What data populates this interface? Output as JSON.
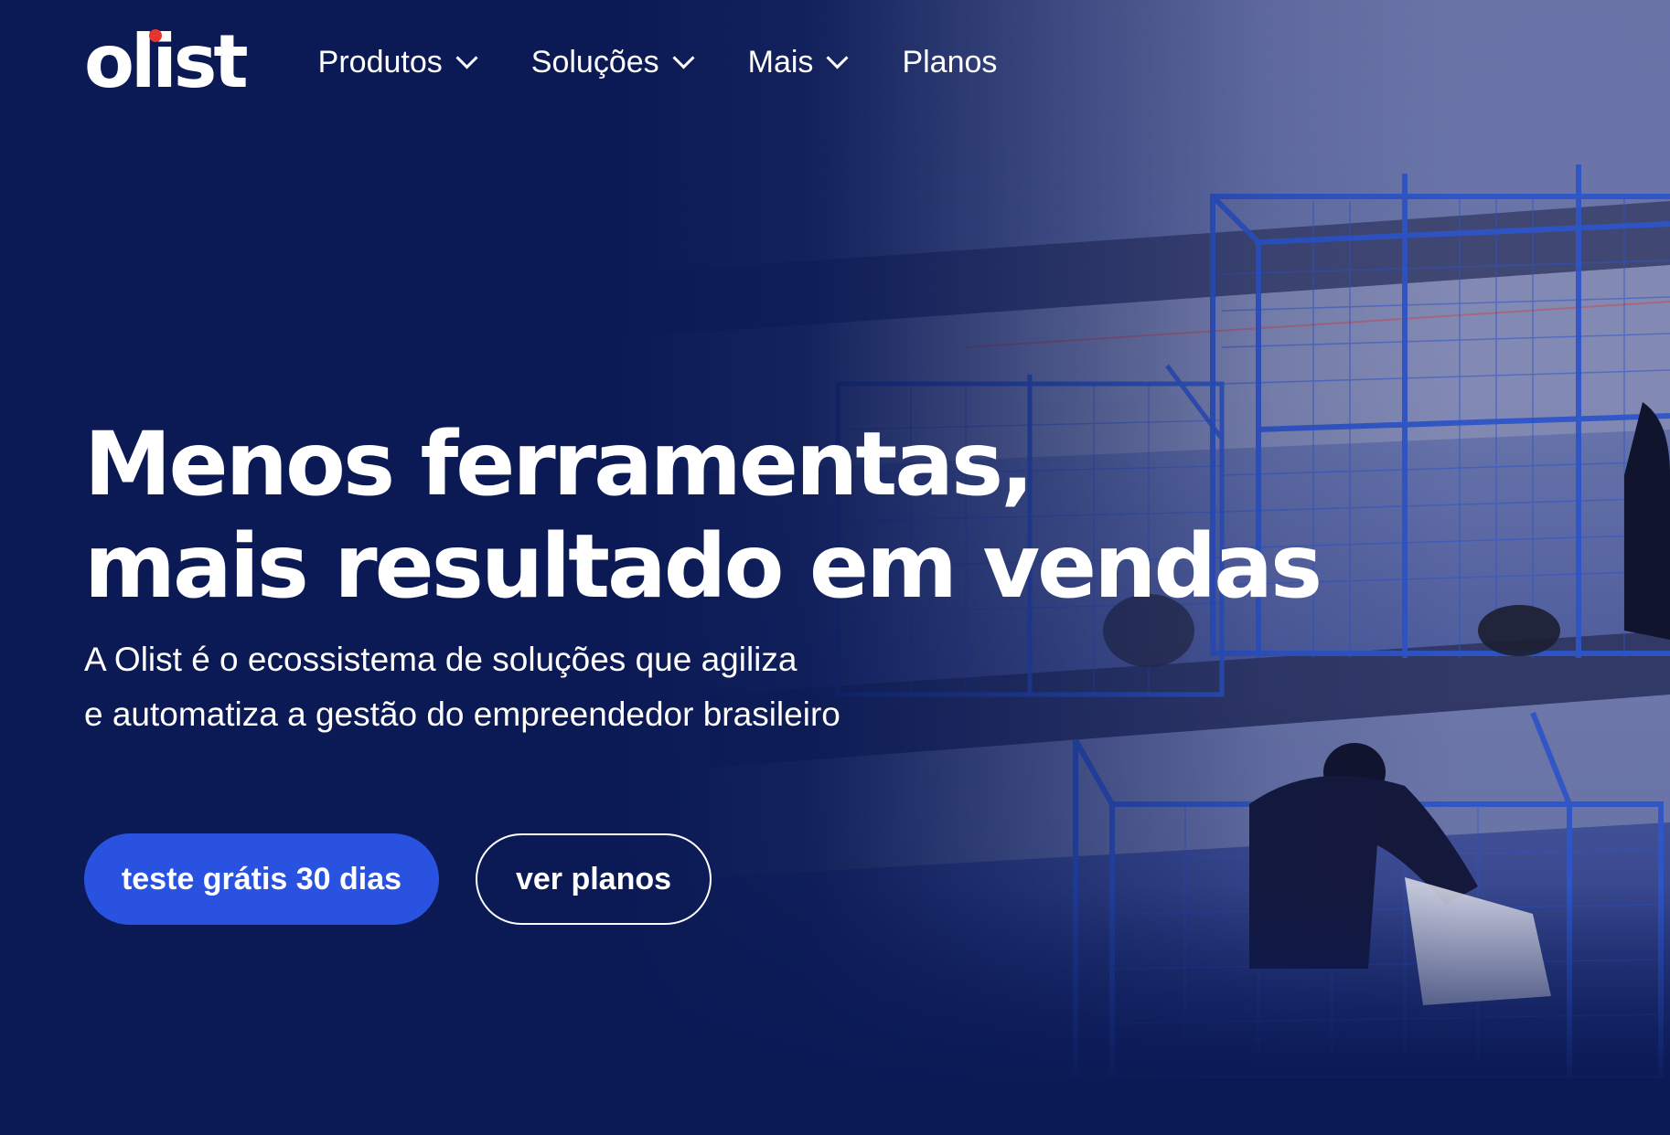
{
  "brand": {
    "logo_text": "olist",
    "accent_dot_color": "#e5352c"
  },
  "nav": {
    "items": [
      {
        "label": "Produtos",
        "has_dropdown": true
      },
      {
        "label": "Soluções",
        "has_dropdown": true
      },
      {
        "label": "Mais",
        "has_dropdown": true
      },
      {
        "label": "Planos",
        "has_dropdown": false
      }
    ]
  },
  "hero": {
    "headline_line1": "Menos ferramentas,",
    "headline_line2": "mais resultado em vendas",
    "subtitle_line1": "A Olist é o ecossistema de soluções que agiliza",
    "subtitle_line2": "e automatiza a gestão do empreendedor brasileiro",
    "primary_cta": "teste grátis 30 dias",
    "secondary_cta": "ver planos"
  },
  "colors": {
    "background": "#0b1a55",
    "primary_button": "#2a52e0",
    "text": "#ffffff"
  }
}
